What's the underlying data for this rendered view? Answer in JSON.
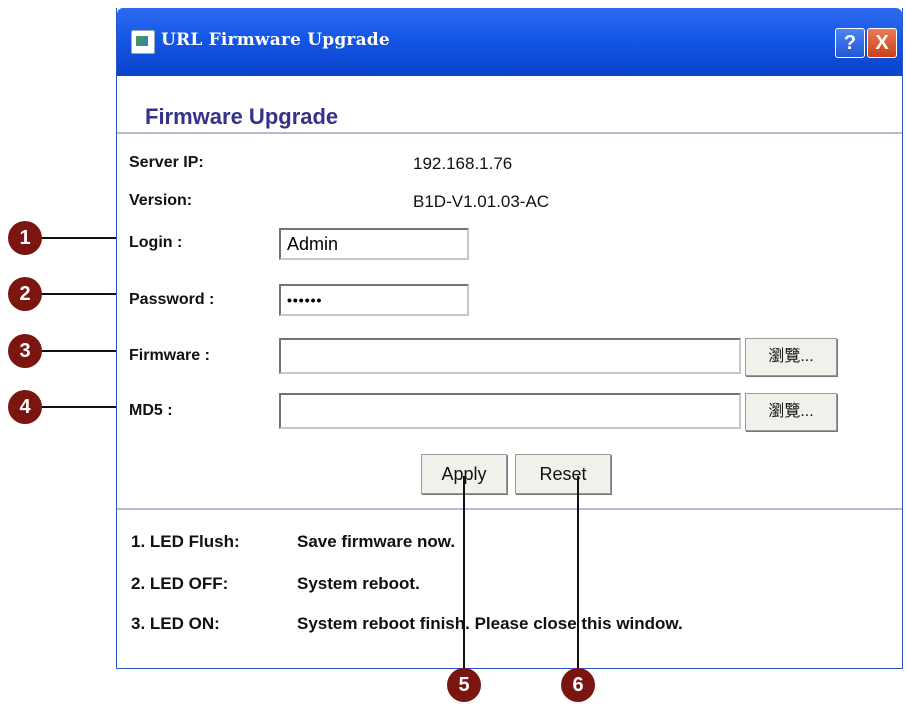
{
  "window": {
    "title": "URL Firmware Upgrade",
    "help_label": "?",
    "close_label": "X"
  },
  "form": {
    "title": "Firmware Upgrade",
    "server_ip_label": "Server IP:",
    "server_ip_value": "192.168.1.76",
    "version_label": "Version:",
    "version_value": "B1D-V1.01.03-AC",
    "login_label": "Login :",
    "login_value": "Admin",
    "password_label": "Password :",
    "password_value": "••••••",
    "firmware_label": "Firmware :",
    "firmware_value": "",
    "md5_label": "MD5 :",
    "md5_value": "",
    "browse_label": "瀏覽...",
    "apply_label": "Apply",
    "reset_label": "Reset"
  },
  "led_notes": [
    {
      "label": "1. LED Flush:",
      "text": "Save firmware now."
    },
    {
      "label": "2. LED OFF:",
      "text": "System reboot."
    },
    {
      "label": "3. LED ON:",
      "text": "System reboot finish. Please close this window."
    }
  ],
  "callouts": [
    "1",
    "2",
    "3",
    "4",
    "5",
    "6"
  ],
  "colors": {
    "titlebar": "#1456e6",
    "form_title": "#33338a",
    "callout": "#7a1510"
  }
}
